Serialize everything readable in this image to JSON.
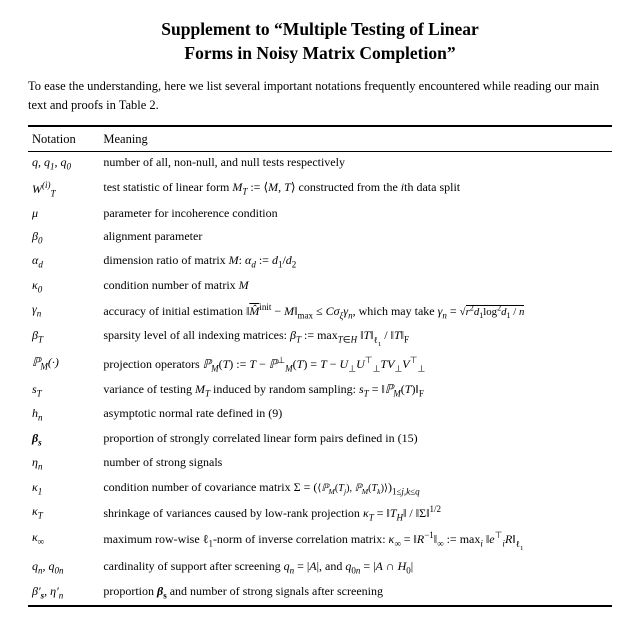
{
  "title": {
    "line1": "Supplement to “Multiple Testing of Linear",
    "line2": "Forms in Noisy Matrix Completion”"
  },
  "intro": "To ease the understanding, here we list several important notations frequently encountered while reading our main text and proofs in Table 2.",
  "table": {
    "col1_header": "Notation",
    "col2_header": "Meaning",
    "rows": [
      {
        "notation_html": "<i>q, q</i><sub>1</sub><i>, q</i><sub>0</sub>",
        "meaning_html": "number of all, non-null, and null tests respectively"
      },
      {
        "notation_html": "<i>W</i><sup>(<i>i</i>)</sup><sub><i>T</i></sub>",
        "meaning_html": "test statistic of linear form <i>M</i><sub><i>T</i></sub> := ⟨<i>M, T</i>⟩ constructed from the <i>i</i>th data split"
      },
      {
        "notation_html": "<i>μ</i>",
        "meaning_html": "parameter for incoherence condition"
      },
      {
        "notation_html": "<i>β</i><sub>0</sub>",
        "meaning_html": "alignment parameter"
      },
      {
        "notation_html": "<i>α</i><sub><i>d</i></sub>",
        "meaning_html": "dimension ratio of matrix <i>M</i>: <i>α</i><sub><i>d</i></sub> := <i>d</i><sub>1</sub>/<i>d</i><sub>2</sub>"
      },
      {
        "notation_html": "<i>κ</i><sub>0</sub>",
        "meaning_html": "condition number of matrix <i>M</i>"
      },
      {
        "notation_html": "<i>γ</i><sub><i>n</i></sub>",
        "meaning_html": "accuracy of initial estimation ‖<span style=\"text-decoration:overline;font-style:italic;\">M&#x0302;</span><sup>init</sup> &minus; <i>M</i>‖<sub>max</sub> &le; <i>Cσ</i><sub><i>ξ</i></sub><i>γ</i><sub><i>n</i></sub>, which may take <i>γ</i><sub><i>n</i></sub> = <span style=\"font-size:0.9em\">&radic;</span><span style=\"border-top:1px solid #000;font-size:0.9em\"><i>r</i><sup>2</sup><i>d</i><sub>1</sub>log<sup>2</sup><i>d</i><sub>1</sub> / <i>n</i></span>"
      },
      {
        "notation_html": "<i>β</i><sub><i>T</i></sub>",
        "meaning_html": "sparsity level of all indexing matrices: <i>β</i><sub><i>T</i></sub> := max<sub><i>T</i>∈<i>H</i></sub> ‖<i>T</i>‖<sub>ℓ<sub>1</sub></sub> / ‖<i>T</i>‖<sub>F</sub>"
      },
      {
        "notation_html": "<i>ℙ</i><sub><i>M</i></sub>(&middot;)",
        "meaning_html": "projection operators <i>ℙ</i><sub><i>M</i></sub>(<i>T</i>) := <i>T</i> &minus; <i>ℙ</i><sup>&perp;</sup><sub><i>M</i></sub>(<i>T</i>) = <i>T</i> &minus; <i>U</i><sub>&perp;</sub><i>U</i><sup>&#x22A4;</sup><sub>&perp;</sub><i>TV</i><sub>&perp;</sub><i>V</i><sup>&#x22A4;</sup><sub>&perp;</sub>"
      },
      {
        "notation_html": "<i>s</i><sub><i>T</i></sub>",
        "meaning_html": "variance of testing <i>M</i><sub><i>T</i></sub> induced by random sampling: <i>s</i><sub><i>T</i></sub> = ‖<i>ℙ</i><sub><i>M</i></sub>(<i>T</i>)‖<sub>F</sub>"
      },
      {
        "notation_html": "<i>h</i><sub><i>n</i></sub>",
        "meaning_html": "asymptotic normal rate defined in (9)"
      },
      {
        "notation_html": "<b><i>β</i></b><sub><b>s</b></sub>",
        "meaning_html": "proportion of strongly correlated linear form pairs defined in (15)"
      },
      {
        "notation_html": "<i>η</i><sub><i>n</i></sub>",
        "meaning_html": "number of strong signals"
      },
      {
        "notation_html": "<i>κ</i><sub>1</sub>",
        "meaning_html": "condition number of covariance matrix &Sigma; = (<span style=\"font-size:0.85em\">⟨<i>ℙ</i><sub><i>M</i></sub>(<i>T</i><sub><i>j</i></sub>), <i>ℙ</i><sub><i>M</i></sub>(<i>T</i><sub><i>k</i></sub>)⟩</span>)<sub style=\"font-size:0.75em\">1&le;<i>j,k</i>&le;<i>q</i></sub>"
      },
      {
        "notation_html": "<i>κ</i><sub><i>T</i></sub>",
        "meaning_html": "shrinkage of variances caused by low-rank projection <i>κ</i><sub><i>T</i></sub> = ‖<i>T</i><sub><i>H</i></sub>‖ / ‖&Sigma;‖<sup>1/2</sup>"
      },
      {
        "notation_html": "<i>κ</i><sub>&infin;</sub>",
        "meaning_html": "maximum row-wise &ell;<sub>1</sub>-norm of inverse correlation matrix: <i>κ</i><sub>&infin;</sub> = ‖<i>R</i><sup>&minus;1</sup>‖<sub>&infin;</sub> := max<sub><i>i</i></sub> ‖<i>e</i><sup>&#x22A4;</sup><sub><i>i</i></sub><i>R</i>‖<sub>&ell;<sub>1</sub></sub>"
      },
      {
        "notation_html": "<i>q</i><sub><i>n</i></sub><i>, q</i><sub>0<i>n</i></sub>",
        "meaning_html": "cardinality of support after screening <i>q</i><sub><i>n</i></sub> = |<i>A</i>|, and <i>q</i><sub>0<i>n</i></sub> = |<i>A</i> &cap; <i>H</i><sub>0</sub>|"
      },
      {
        "notation_html": "<i>β′</i><sub><b>s</b></sub><i>, η′</i><sub><i>n</i></sub>",
        "meaning_html": "proportion <b><i>β</i></b><sub><b>s</b></sub> and number of strong signals after screening"
      }
    ]
  }
}
